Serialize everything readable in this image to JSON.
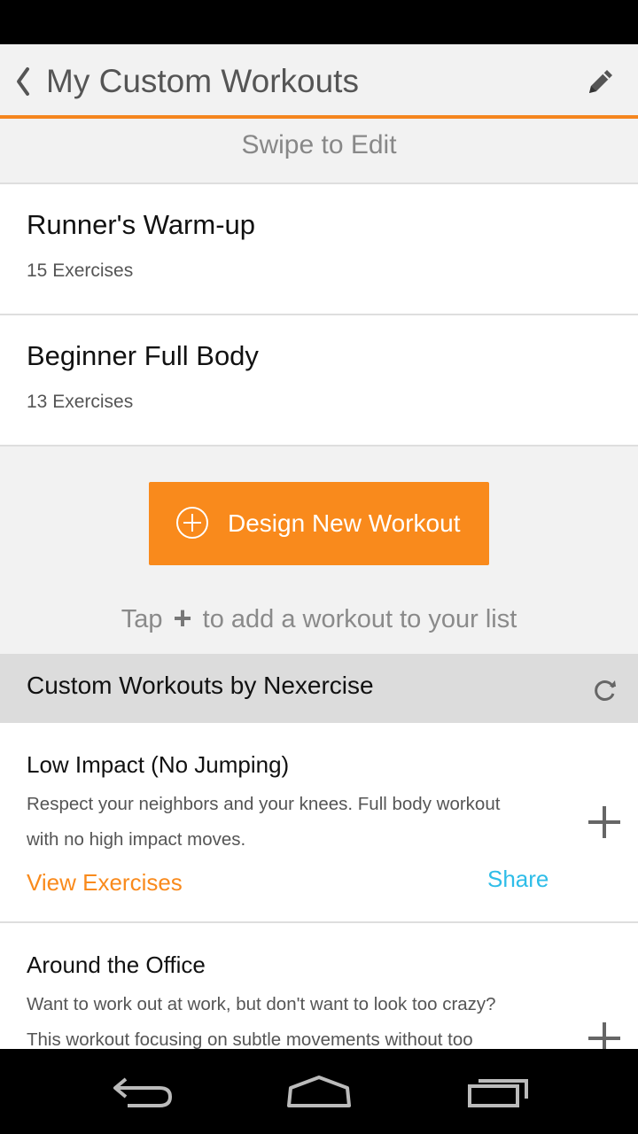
{
  "header": {
    "title": "My Custom Workouts"
  },
  "swipe_hint": "Swipe to Edit",
  "my_workouts": [
    {
      "name": "Runner's Warm-up",
      "count": "15 Exercises"
    },
    {
      "name": "Beginner Full Body",
      "count": "13 Exercises"
    }
  ],
  "design_button": {
    "label": "Design New Workout"
  },
  "tap_hint": {
    "before": "Tap",
    "after": "to add a workout to your list"
  },
  "section": {
    "title": "Custom Workouts by Nexercise"
  },
  "nexercise_workouts": [
    {
      "title": "Low Impact (No Jumping)",
      "desc_line1": "Respect your neighbors and your knees. Full body workout",
      "desc_line2": "with no high impact moves.",
      "view_label": "View Exercises",
      "share_label": "Share"
    },
    {
      "title": "Around the Office",
      "desc_line1": "Want to work out at work, but don't want to look too crazy?",
      "desc_line2": "This workout focusing on subtle movements without too"
    }
  ],
  "colors": {
    "accent": "#f98a1c",
    "share": "#2ebde8"
  },
  "icons": [
    "back-chevron-icon",
    "pencil-icon",
    "plus-circle-icon",
    "refresh-icon",
    "plus-icon",
    "nav-back-icon",
    "nav-home-icon",
    "nav-recents-icon"
  ]
}
